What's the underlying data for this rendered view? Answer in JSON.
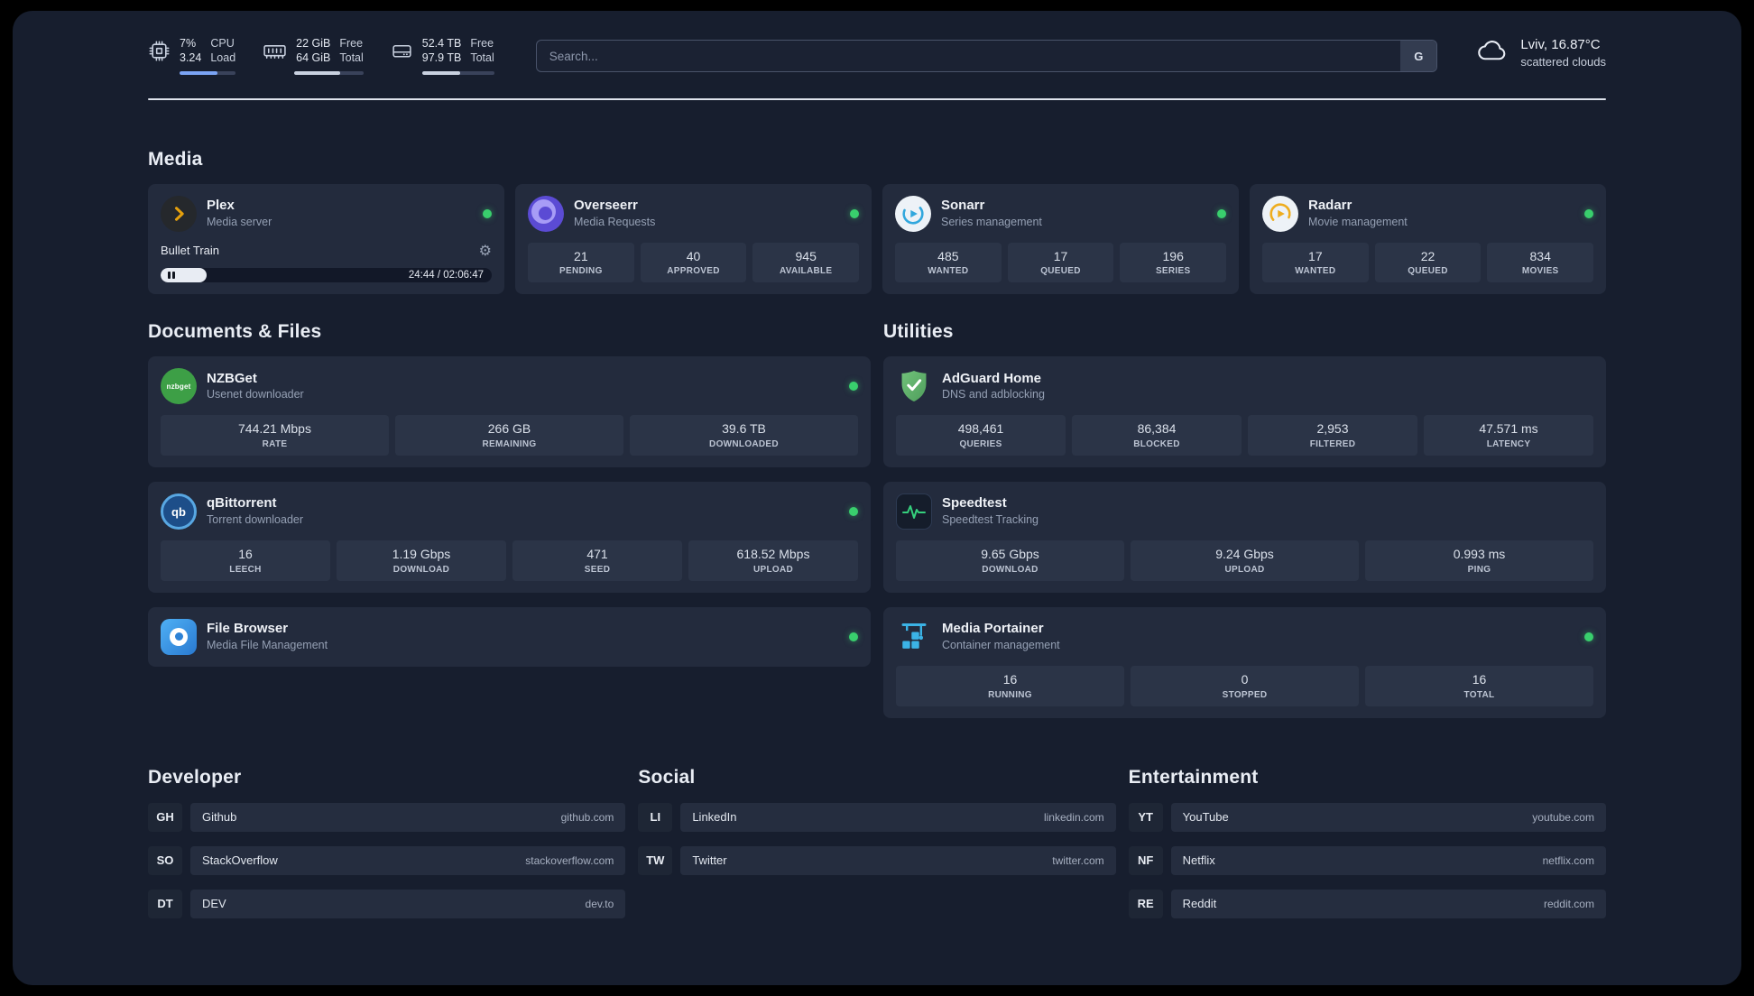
{
  "topbar": {
    "cpu": {
      "percent": "7%",
      "load_avg": "3.24",
      "label_top": "CPU",
      "label_bottom": "Load",
      "bar_style": "width:68%"
    },
    "memory": {
      "free": "22 GiB",
      "total": "64 GiB",
      "label_top": "Free",
      "label_bottom": "Total",
      "bar_style": "width:66%"
    },
    "disk": {
      "free": "52.4 TB",
      "total": "97.9 TB",
      "label_top": "Free",
      "label_bottom": "Total",
      "bar_style": "width:53%"
    },
    "search": {
      "placeholder": "Search...",
      "engine_button": "G"
    },
    "weather": {
      "location": "Lviv, 16.87°C",
      "condition": "scattered clouds"
    }
  },
  "media": {
    "title": "Media",
    "plex": {
      "name": "Plex",
      "desc": "Media server",
      "now_playing": "Bullet Train",
      "time": "24:44 / 02:06:47",
      "progress_style": "width:14%"
    },
    "overseerr": {
      "name": "Overseerr",
      "desc": "Media Requests",
      "stats": [
        {
          "value": "21",
          "label": "PENDING"
        },
        {
          "value": "40",
          "label": "APPROVED"
        },
        {
          "value": "945",
          "label": "AVAILABLE"
        }
      ]
    },
    "sonarr": {
      "name": "Sonarr",
      "desc": "Series management",
      "stats": [
        {
          "value": "485",
          "label": "WANTED"
        },
        {
          "value": "17",
          "label": "QUEUED"
        },
        {
          "value": "196",
          "label": "SERIES"
        }
      ]
    },
    "radarr": {
      "name": "Radarr",
      "desc": "Movie management",
      "stats": [
        {
          "value": "17",
          "label": "WANTED"
        },
        {
          "value": "22",
          "label": "QUEUED"
        },
        {
          "value": "834",
          "label": "MOVIES"
        }
      ]
    }
  },
  "documents": {
    "title": "Documents & Files",
    "nzbget": {
      "name": "NZBGet",
      "desc": "Usenet downloader",
      "icon_text": "nzbget",
      "stats": [
        {
          "value": "744.21 Mbps",
          "label": "RATE"
        },
        {
          "value": "266 GB",
          "label": "REMAINING"
        },
        {
          "value": "39.6 TB",
          "label": "DOWNLOADED"
        }
      ]
    },
    "qbittorrent": {
      "name": "qBittorrent",
      "desc": "Torrent downloader",
      "icon_text": "qb",
      "stats": [
        {
          "value": "16",
          "label": "LEECH"
        },
        {
          "value": "1.19 Gbps",
          "label": "DOWNLOAD"
        },
        {
          "value": "471",
          "label": "SEED"
        },
        {
          "value": "618.52 Mbps",
          "label": "UPLOAD"
        }
      ]
    },
    "filebrowser": {
      "name": "File Browser",
      "desc": "Media File Management"
    }
  },
  "utilities": {
    "title": "Utilities",
    "adguard": {
      "name": "AdGuard Home",
      "desc": "DNS and adblocking",
      "stats": [
        {
          "value": "498,461",
          "label": "QUERIES"
        },
        {
          "value": "86,384",
          "label": "BLOCKED"
        },
        {
          "value": "2,953",
          "label": "FILTERED"
        },
        {
          "value": "47.571 ms",
          "label": "LATENCY"
        }
      ]
    },
    "speedtest": {
      "name": "Speedtest",
      "desc": "Speedtest Tracking",
      "stats": [
        {
          "value": "9.65 Gbps",
          "label": "DOWNLOAD"
        },
        {
          "value": "9.24 Gbps",
          "label": "UPLOAD"
        },
        {
          "value": "0.993 ms",
          "label": "PING"
        }
      ]
    },
    "portainer": {
      "name": "Media Portainer",
      "desc": "Container management",
      "stats": [
        {
          "value": "16",
          "label": "RUNNING"
        },
        {
          "value": "0",
          "label": "STOPPED"
        },
        {
          "value": "16",
          "label": "TOTAL"
        }
      ]
    }
  },
  "bookmarks": {
    "developer": {
      "title": "Developer",
      "links": [
        {
          "abbr": "GH",
          "name": "Github",
          "url": "github.com"
        },
        {
          "abbr": "SO",
          "name": "StackOverflow",
          "url": "stackoverflow.com"
        },
        {
          "abbr": "DT",
          "name": "DEV",
          "url": "dev.to"
        }
      ]
    },
    "social": {
      "title": "Social",
      "links": [
        {
          "abbr": "LI",
          "name": "LinkedIn",
          "url": "linkedin.com"
        },
        {
          "abbr": "TW",
          "name": "Twitter",
          "url": "twitter.com"
        }
      ]
    },
    "entertainment": {
      "title": "Entertainment",
      "links": [
        {
          "abbr": "YT",
          "name": "YouTube",
          "url": "youtube.com"
        },
        {
          "abbr": "NF",
          "name": "Netflix",
          "url": "netflix.com"
        },
        {
          "abbr": "RE",
          "name": "Reddit",
          "url": "reddit.com"
        }
      ]
    }
  },
  "colors": {
    "panel_background": "#171e2e",
    "card_background": "#232b3d",
    "tile_background": "#2b3447",
    "status_online": "#39cf6d",
    "plex_accent": "#e5a00d",
    "cpu_bar": "#7ba4f5",
    "divider": "#dee3ec"
  }
}
